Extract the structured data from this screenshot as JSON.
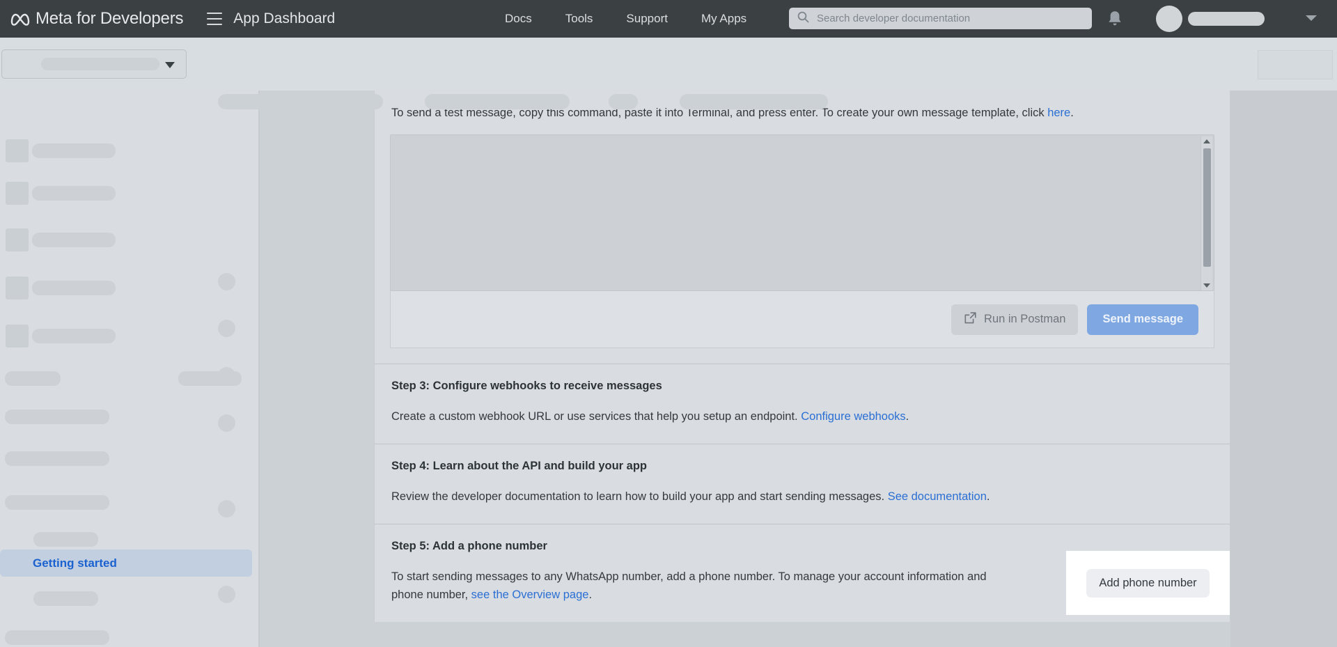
{
  "topnav": {
    "brand": "Meta for Developers",
    "menu_icon": "hamburger-icon",
    "app_dashboard": "App Dashboard",
    "links": [
      {
        "label": "Docs"
      },
      {
        "label": "Tools"
      },
      {
        "label": "Support"
      },
      {
        "label": "My Apps"
      }
    ],
    "search": {
      "icon": "search-icon",
      "placeholder": "Search developer documentation",
      "value": ""
    },
    "notifications_icon": "bell-icon",
    "account_caret_icon": "chevron-down-icon",
    "background_color": "#3b4043"
  },
  "subbar": {
    "app_selector_caret": "chevron-down-icon"
  },
  "sidebar": {
    "active_item": "Getting started",
    "active_color": "#1b62d0",
    "active_background": "#c2cfe0"
  },
  "main": {
    "intro": {
      "text": "To send a test message, copy this command, paste it into Terminal, and press enter. To create your own message template, click ",
      "link": "here",
      "period": "."
    },
    "editor": {
      "value": "",
      "scrollbar_up_icon": "triangle-up-icon",
      "scrollbar_down_icon": "triangle-down-icon"
    },
    "actions": {
      "postman_icon": "external-link-icon",
      "postman_label": "Run in Postman",
      "send_label": "Send message",
      "send_color": "#7fa8e2"
    },
    "steps": [
      {
        "title": "Step 3: Configure webhooks to receive messages",
        "body_before": "Create a custom webhook URL or use services that help you setup an endpoint. ",
        "link": "Configure webhooks",
        "body_after": "."
      },
      {
        "title": "Step 4: Learn about the API and build your app",
        "body_before": "Review the developer documentation to learn how to build your app and start sending messages. ",
        "link": "See documentation",
        "body_after": "."
      },
      {
        "title": "Step 5: Add a phone number",
        "body_before": "To start sending messages to any WhatsApp number, add a phone number. To manage your account information and phone number, ",
        "link": "see the Overview page",
        "body_after": "."
      }
    ]
  },
  "callout": {
    "add_phone_label": "Add phone number",
    "background": "#ffffff"
  }
}
